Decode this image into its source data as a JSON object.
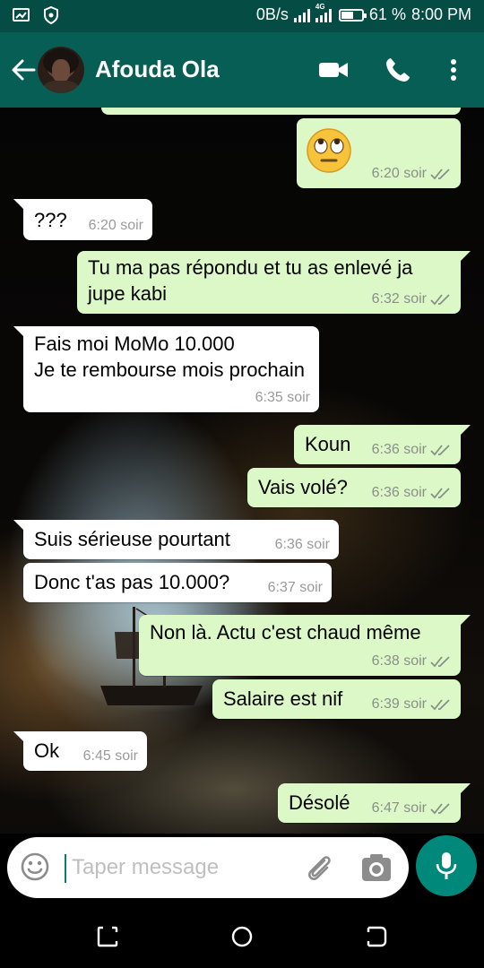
{
  "status_bar": {
    "left_icons": [
      "screen-cast-icon",
      "shield-icon"
    ],
    "network_speed": "0B/s",
    "network_type": "4G",
    "battery_percent": "61 %",
    "battery_level": 0.61,
    "time": "8:00 PM"
  },
  "header": {
    "contact_name": "Afouda Ola",
    "icons": [
      "back-arrow-icon",
      "video-call-icon",
      "phone-call-icon",
      "more-options-icon"
    ],
    "color": "#075e54"
  },
  "messages": [
    {
      "direction": "out",
      "emoji": "face-with-rolling-eyes",
      "time": "6:20 soir",
      "status": "read"
    },
    {
      "direction": "in",
      "text": "???",
      "time": "6:20 soir"
    },
    {
      "direction": "out",
      "lines": [
        "Tu ma pas répondu et tu as enlevé ja",
        "jupe kabi"
      ],
      "time": "6:32 soir",
      "status": "read"
    },
    {
      "direction": "in",
      "lines": [
        "Fais moi MoMo 10.000",
        "Je te rembourse mois prochain"
      ],
      "time": "6:35 soir"
    },
    {
      "direction": "out",
      "text": "Koun",
      "time": "6:36 soir",
      "status": "read"
    },
    {
      "direction": "out",
      "text": "Vais volé?",
      "time": "6:36 soir",
      "status": "read"
    },
    {
      "direction": "in",
      "text": "Suis sérieuse pourtant",
      "time": "6:36 soir"
    },
    {
      "direction": "in",
      "text": "Donc t'as pas 10.000?",
      "time": "6:37 soir"
    },
    {
      "direction": "out",
      "text": "Non là. Actu c'est chaud même",
      "time": "6:38 soir",
      "status": "read"
    },
    {
      "direction": "out",
      "text": "Salaire est nif",
      "time": "6:39 soir",
      "status": "read"
    },
    {
      "direction": "in",
      "text": "Ok",
      "time": "6:45 soir"
    },
    {
      "direction": "out",
      "text": "Désolé",
      "time": "6:47 soir",
      "status": "read"
    }
  ],
  "composer": {
    "placeholder": "Taper message",
    "icons": [
      "emoji-icon",
      "attach-icon",
      "camera-icon",
      "microphone-icon"
    ]
  },
  "nav_bar": {
    "icons": [
      "recent-apps-icon",
      "home-icon",
      "back-icon"
    ]
  },
  "colors": {
    "outgoing_bubble": "#dcf8c6",
    "incoming_bubble": "#ffffff",
    "accent": "#00897b",
    "status_bar": "#054d44"
  }
}
